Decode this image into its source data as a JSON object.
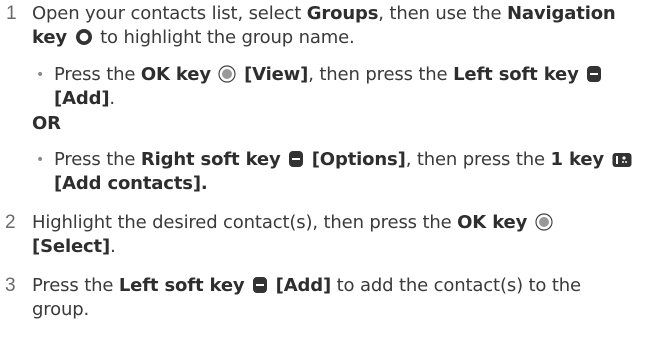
{
  "steps": [
    {
      "number": "1",
      "line1": {
        "t1": "Open your contacts list, select ",
        "b1": "Groups",
        "t2": ", then use the ",
        "b2": "Navigation"
      },
      "line2": {
        "b1": "key",
        "t1": " to highlight the group name."
      },
      "option_a": {
        "l1": {
          "t1": "Press the ",
          "b1": "OK key",
          "b2": "[View]",
          "t2": ", then press the ",
          "b3": "Left soft key"
        },
        "l2": {
          "b1": "[Add]",
          "t1": "."
        }
      },
      "or_label": "OR",
      "option_b": {
        "l1": {
          "t1": "Press the ",
          "b1": "Right soft key",
          "b2": "[Options]",
          "t2": ", then press the ",
          "b3": "1 key"
        },
        "l2": {
          "b1": "[Add contacts]."
        }
      }
    },
    {
      "number": "2",
      "line1": {
        "t1": "Highlight the desired contact(s), then press the ",
        "b1": "OK key"
      },
      "line2": {
        "b1": "[Select]",
        "t1": "."
      }
    },
    {
      "number": "3",
      "line1": {
        "t1": "Press the ",
        "b1": "Left soft key",
        "b2": "[Add]",
        "t2": " to add the contact(s) to the"
      },
      "line2": {
        "t1": "group."
      }
    }
  ],
  "icons": {
    "navigation_key": "navigation-key-icon",
    "ok_key": "ok-key-icon",
    "soft_key": "soft-key-icon",
    "one_key": "one-key-icon"
  },
  "colors": {
    "text": "#3a3a3a",
    "bold": "#2e2e2e",
    "number": "#6a6a6a",
    "icon": "#333333"
  }
}
